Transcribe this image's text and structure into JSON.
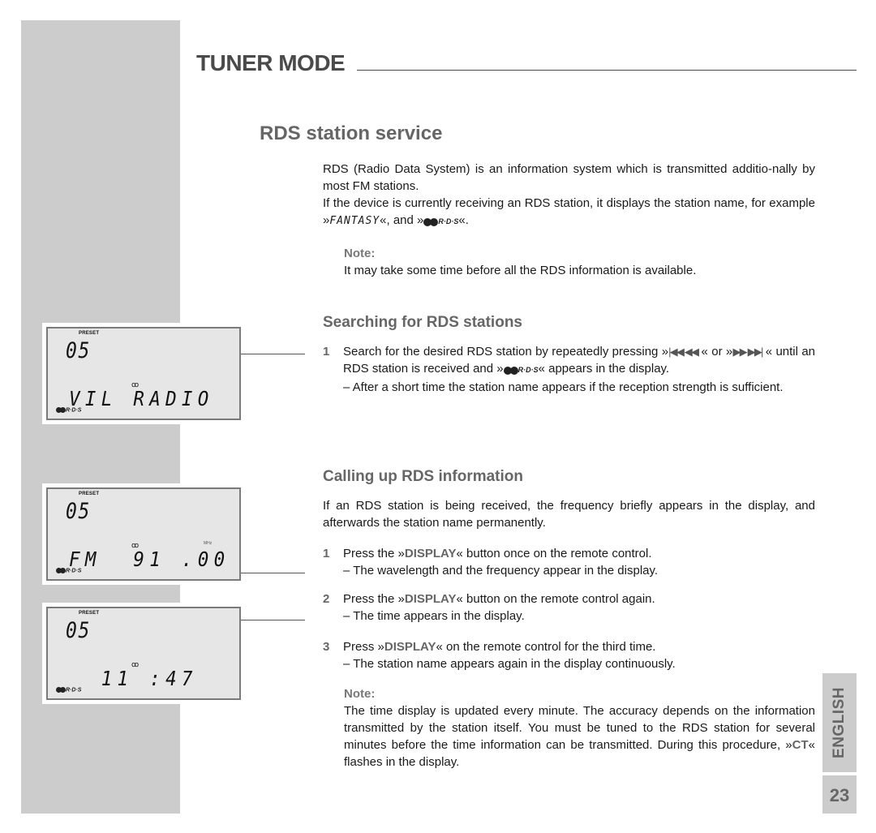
{
  "header": {
    "title": "TUNER MODE"
  },
  "section": {
    "title": "RDS station service",
    "intro_1": "RDS (Radio Data System) is an information system which is transmitted additio-nally by most FM stations.",
    "intro_2_pre": "If the device is currently receiving an RDS station, it displays the station name, for example »",
    "intro_2_example": "FANTASY",
    "intro_2_mid": "«, and »",
    "intro_2_post": "«.",
    "note_label": "Note:",
    "note_text": "It may take some time before all the RDS information is available."
  },
  "rds_logo": {
    "icon": "rds-logo-icon",
    "text": "R·D·S"
  },
  "searching": {
    "title": "Searching for RDS stations",
    "step1_num": "1",
    "step1_a": "Search for the desired RDS station by repeatedly pressing »",
    "step1_btn1": "|◀◀  ◀◀",
    "step1_b": " « or »",
    "step1_btn2": "▶▶  ▶▶|",
    "step1_c": " « until an RDS station is received and »",
    "step1_d": "« appears in the display.",
    "step1_sub": "– After a short time the station name appears if the reception strength is sufficient."
  },
  "calling": {
    "title": "Calling up RDS information",
    "intro": "If an RDS station is being received, the frequency briefly appears in the display, and afterwards the station name permanently.",
    "steps": [
      {
        "num": "1",
        "pre": "Press the »",
        "kw": "DISPLAY",
        "post": "«  button once on the remote control.",
        "sub": "– The wavelength and the frequency appear in the display."
      },
      {
        "num": "2",
        "pre": "Press the »",
        "kw": "DISPLAY",
        "post": "«  button on the remote control again.",
        "sub": "– The time appears in the display."
      },
      {
        "num": "3",
        "pre": "Press »",
        "kw": "DISPLAY",
        "post": "«  on the remote control for the third time.",
        "sub": "– The station name appears again in the display continuously."
      }
    ],
    "note_label": "Note:",
    "note_pre": "The time display is updated every minute. The accuracy depends on the information transmitted by the station itself. You must be tuned to the RDS station for several minutes before the time information can be transmitted. During this procedure, »",
    "note_kw": "CT",
    "note_post": "« flashes in the display."
  },
  "displays": [
    {
      "preset_label": "PRESET",
      "preset": "05",
      "stereo": "ꝏ",
      "main": "VIL RADIO",
      "unit": "",
      "rds": "R·D·S"
    },
    {
      "preset_label": "PRESET",
      "preset": "05",
      "stereo": "ꝏ",
      "main": "FM  91 .00",
      "unit": "MHz",
      "rds": "R·D·S"
    },
    {
      "preset_label": "PRESET",
      "preset": "05",
      "stereo": "ꝏ",
      "main": "  11 :47",
      "unit": "",
      "rds": "R·D·S"
    }
  ],
  "side_tab": {
    "language": "ENGLISH",
    "page": "23"
  }
}
